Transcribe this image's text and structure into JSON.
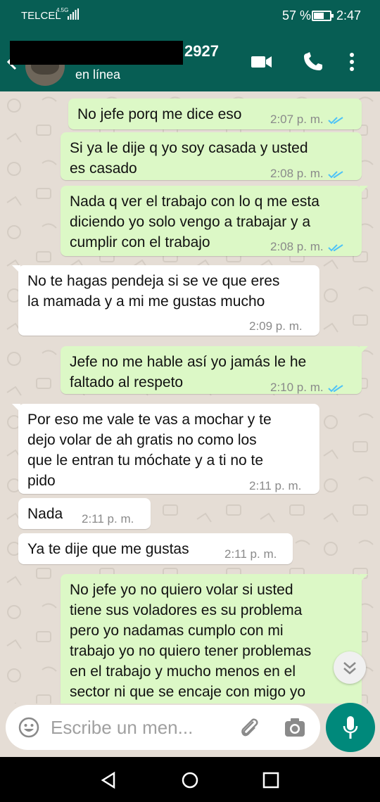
{
  "status_bar": {
    "carrier": "TELCEL",
    "network": "4.5G",
    "battery": "57 %",
    "battery_level": 0.57,
    "time": "2:47"
  },
  "header": {
    "contact_name": "2927",
    "contact_status": "en línea",
    "icons": [
      "back-arrow-icon",
      "avatar",
      "video-call-icon",
      "phone-icon",
      "more-options-icon"
    ]
  },
  "messages": [
    {
      "direction": "out",
      "text": "No jefe porq me dice eso",
      "time": "2:07 p. m.",
      "status": "read"
    },
    {
      "direction": "out",
      "text": "Si ya le dije q yo soy casada y usted\nes casado",
      "time": "2:08 p. m.",
      "status": "read"
    },
    {
      "direction": "out",
      "text": "Nada q ver el trabajo con lo q me esta\ndiciendo yo solo vengo a trabajar y a\ncumplir con el trabajo",
      "time": "2:08 p. m.",
      "status": "read"
    },
    {
      "direction": "in",
      "text": "No te hagas pendeja si se ve que eres\nla mamada y a mi me gustas mucho",
      "time": "2:09 p. m."
    },
    {
      "direction": "out",
      "text": "Jefe no me hable así yo jamás le he\nfaltado al respeto",
      "time": "2:10 p. m.",
      "status": "read"
    },
    {
      "direction": "in",
      "text": "Por eso me vale te vas a mochar y te\ndejo volar de ah gratis no como los\nque le entran tu móchate y a ti no te\npido",
      "time": "2:11 p. m."
    },
    {
      "direction": "in",
      "text": "Nada",
      "time": "2:11 p. m."
    },
    {
      "direction": "in",
      "text": "Ya te dije que me gustas",
      "time": "2:11 p. m."
    },
    {
      "direction": "out",
      "text": "No jefe yo no quiero volar si usted\ntiene sus voladores es su problema\npero yo nadamas cumplo con mi\ntrabajo yo no quiero tener problemas\nen el trabajo y mucho menos en el\nsector ni que se encaje con migo yo",
      "time": "",
      "status": ""
    }
  ],
  "composer": {
    "placeholder": "Escribe un men..."
  },
  "colors": {
    "header": "#075e54",
    "outgoing_bubble": "#dcf8c6",
    "incoming_bubble": "#ffffff",
    "chat_background": "#e5ddd5",
    "read_tick": "#4fc3f7",
    "mic_button": "#00897b"
  }
}
